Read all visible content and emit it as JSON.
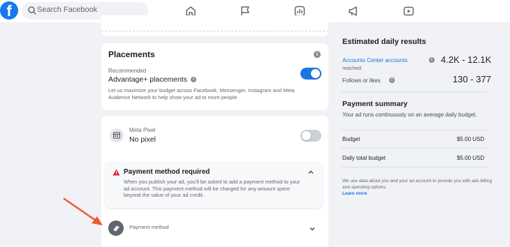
{
  "topbar": {
    "logo_letter": "f",
    "search_placeholder": "Search Facebook",
    "nav_icons": [
      "home-icon",
      "flag-icon",
      "chart-icon",
      "megaphone-icon",
      "video-icon"
    ]
  },
  "placements": {
    "title": "Placements",
    "recommended": "Recommended",
    "option": "Advantage+ placements",
    "description": "Let us maximize your budget across Facebook, Messenger, Instagram and Meta Audience Network to help show your ad to more people.",
    "toggle_on": true
  },
  "pixel": {
    "caption": "Meta Pixel",
    "value": "No pixel",
    "toggle_on": false
  },
  "payment_warning": {
    "title": "Payment method required",
    "text": "When you publish your ad, you'll be asked to add a payment method to your ad account. This payment method will be charged for any amount spent beyond the value of your ad credit."
  },
  "payment_method": {
    "label": "Payment method"
  },
  "estimated": {
    "title": "Estimated daily results",
    "reach_link": "Accounts Center accounts",
    "reach_sub": "reached",
    "reach_value": "4.2K - 12.1K",
    "follows_label": "Follows or likes",
    "follows_value": "130 - 377"
  },
  "summary": {
    "title": "Payment summary",
    "description": "Your ad runs continuously on an average daily budget.",
    "rows": [
      {
        "label": "Budget",
        "value": "$5.00 USD"
      },
      {
        "label": "Daily total budget",
        "value": "$5.00 USD"
      }
    ],
    "footnote": "We use data about you and your ad account to provide you with ads billing and spending options.",
    "learn_more": "Learn more"
  },
  "colors": {
    "brand": "#1877f2",
    "toggle_on": "#1b74e4",
    "toggle_off": "#ccd0d5",
    "warning": "#e41e3f",
    "annotation_arrow": "#ec5a33"
  }
}
